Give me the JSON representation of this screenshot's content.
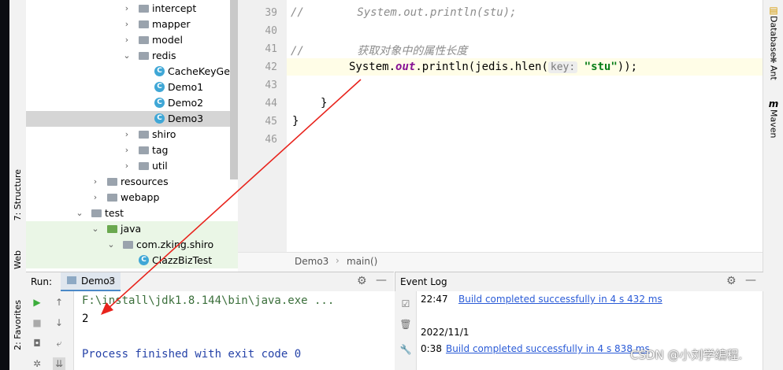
{
  "left_stripe": {
    "structure": "7: Structure",
    "web": "Web",
    "favorites": "2: Favorites"
  },
  "tree": {
    "items": [
      {
        "label": "intercept",
        "kind": "pkg",
        "arrow": "›"
      },
      {
        "label": "mapper",
        "kind": "pkg",
        "arrow": "›"
      },
      {
        "label": "model",
        "kind": "pkg",
        "arrow": "›"
      },
      {
        "label": "redis",
        "kind": "pkg",
        "arrow": "⌄"
      },
      {
        "label": "CacheKeyGener",
        "kind": "class"
      },
      {
        "label": "Demo1",
        "kind": "class"
      },
      {
        "label": "Demo2",
        "kind": "class"
      },
      {
        "label": "Demo3",
        "kind": "class",
        "selected": true
      },
      {
        "label": "shiro",
        "kind": "pkg",
        "arrow": "›"
      },
      {
        "label": "tag",
        "kind": "pkg",
        "arrow": "›"
      },
      {
        "label": "util",
        "kind": "pkg",
        "arrow": "›"
      },
      {
        "label": "resources",
        "kind": "pkg",
        "arrow": "›"
      },
      {
        "label": "webapp",
        "kind": "pkg",
        "arrow": "›"
      },
      {
        "label": "test",
        "kind": "folder",
        "arrow": "⌄"
      },
      {
        "label": "java",
        "kind": "src",
        "arrow": "⌄"
      },
      {
        "label": "com.zking.shiro",
        "kind": "pkg",
        "arrow": "⌄"
      },
      {
        "label": "ClazzBizTest",
        "kind": "class"
      }
    ]
  },
  "editor": {
    "lines": [
      {
        "num": "39",
        "comment": "//        System.out.println(stu);"
      },
      {
        "num": "40"
      },
      {
        "num": "41",
        "comment": "//        获取对象中的属性长度"
      },
      {
        "num": "42",
        "pre": "System.",
        "static_field": "out",
        "mid": ".println(jedis.hlen(",
        "hint": "key:",
        "string": "\"stu\"",
        "post": "));"
      },
      {
        "num": "43"
      },
      {
        "num": "44",
        "text": "}"
      },
      {
        "num": "45",
        "text": "}"
      },
      {
        "num": "46"
      }
    ],
    "breadcrumb": [
      "Demo3",
      "main()"
    ]
  },
  "right_stripe": {
    "database": "Database",
    "ant": "Ant",
    "maven": "Maven"
  },
  "run": {
    "label": "Run:",
    "tab": "Demo3",
    "console": [
      "F:\\install\\jdk1.8.144\\bin\\java.exe ...",
      "2",
      "",
      "Process finished with exit code 0"
    ]
  },
  "event_log": {
    "title": "Event Log",
    "entries": [
      {
        "time": "22:47",
        "message": "Build completed successfully in 4 s 432 ms"
      },
      {
        "date": "2022/11/1"
      },
      {
        "time": "0:38",
        "message": "Build completed successfully in 4 s 838 ms"
      }
    ]
  },
  "watermark": "CSDN @小刘学编程.",
  "colors": {
    "selection": "#d5d5d5",
    "current_line": "#fffde7",
    "link": "#2a5bd7",
    "annotation_arrow": "#e8231c"
  }
}
